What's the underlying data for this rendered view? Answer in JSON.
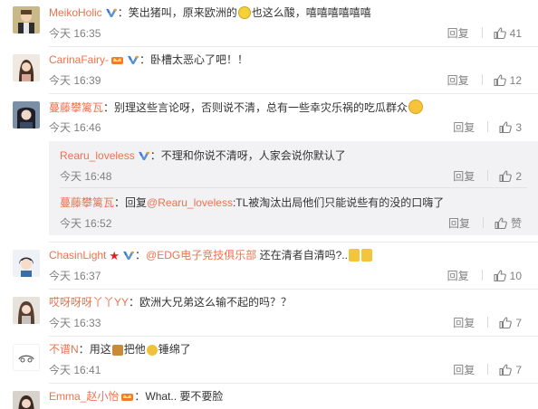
{
  "icons": {
    "vip": "vip-badge-icon",
    "like": "thumbs-up-icon",
    "heart": "heart-icon"
  },
  "colors": {
    "username": "#eb7350",
    "meta": "#808080",
    "text": "#333333",
    "reply_bg": "#f2f2f5"
  },
  "comments": [
    {
      "username": "MeikoHolic",
      "text_a": "笑出猪叫，原来欧洲的",
      "text_b": "也这么酸，嘻嘻嘻嘻嘻嘻",
      "time": "今天 16:35",
      "reply": "回复",
      "likes": "41"
    },
    {
      "username": "CarinaFairy-",
      "text": "卧槽太恶心了吧！！",
      "time": "今天 16:39",
      "reply": "回复",
      "likes": "12"
    },
    {
      "username": "蔓藤攀篱瓦",
      "text": "别理这些言论呀，否则说不清，总有一些幸灾乐祸的吃瓜群众",
      "time": "今天 16:46",
      "reply": "回复",
      "likes": "3",
      "replies": [
        {
          "username": "Rearu_loveless",
          "text": "不理和你说不清呀，人家会说你默认了",
          "time": "今天 16:48",
          "reply": "回复",
          "likes": "2"
        },
        {
          "username": "蔓藤攀篱瓦",
          "prefix": "回复",
          "mention": "@Rearu_loveless",
          "text": ":TL被淘汰出局他们只能说些有的没的口嗨了",
          "time": "今天 16:52",
          "reply": "回复",
          "likes": "赞"
        }
      ]
    },
    {
      "username": "ChasinLight",
      "mention": "@EDG电子竞技俱乐部",
      "text": " 还在清者自清吗?..",
      "time": "今天 16:37",
      "reply": "回复",
      "likes": "10"
    },
    {
      "username": "哎呀呀呀丫丫YY",
      "text": "欧洲大兄弟这么输不起的吗？？",
      "time": "今天 16:33",
      "reply": "回复",
      "likes": "7"
    },
    {
      "username": "不谱N",
      "text_a": "用这",
      "text_b": "把他",
      "text_c": "锤绵了",
      "time": "今天 16:41",
      "reply": "回复",
      "likes": "7"
    },
    {
      "username": "Emma_赵小怡",
      "text": "What.. 要不要脸"
    }
  ]
}
